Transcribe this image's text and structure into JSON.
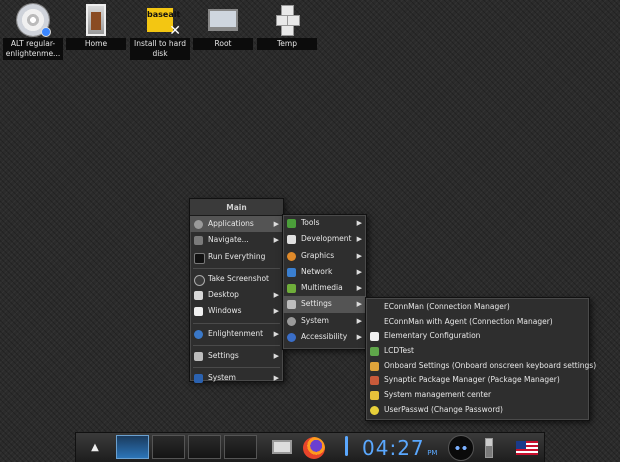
{
  "desktop": {
    "icons": [
      {
        "label": "ALT regular-enlightenme..."
      },
      {
        "label": "Home"
      },
      {
        "label": "Install to hard disk",
        "badge_text": "basealt"
      },
      {
        "label": "Root"
      },
      {
        "label": "Temp"
      }
    ]
  },
  "main_menu": {
    "title": "Main",
    "items": [
      {
        "label": "Applications",
        "icon": "gear-icon",
        "has_submenu": true
      },
      {
        "label": "Navigate...",
        "icon": "folder-icon",
        "has_submenu": true
      },
      {
        "label": "Run Everything",
        "icon": "terminal-icon",
        "has_submenu": false
      },
      {
        "label": "Take Screenshot",
        "icon": "camera-icon",
        "has_submenu": false
      },
      {
        "label": "Desktop",
        "icon": "desktop-icon",
        "has_submenu": true
      },
      {
        "label": "Windows",
        "icon": "window-icon",
        "has_submenu": true
      },
      {
        "label": "Enlightenment",
        "icon": "enlightenment-icon",
        "has_submenu": true
      },
      {
        "label": "Settings",
        "icon": "wrench-icon",
        "has_submenu": true
      },
      {
        "label": "System",
        "icon": "system-icon",
        "has_submenu": true
      }
    ]
  },
  "applications_menu": {
    "items": [
      {
        "label": "Tools",
        "icon": "tools-icon"
      },
      {
        "label": "Development",
        "icon": "development-icon"
      },
      {
        "label": "Graphics",
        "icon": "graphics-icon"
      },
      {
        "label": "Network",
        "icon": "network-icon"
      },
      {
        "label": "Multimedia",
        "icon": "multimedia-icon"
      },
      {
        "label": "Settings",
        "icon": "settings-icon"
      },
      {
        "label": "System",
        "icon": "system-icon"
      },
      {
        "label": "Accessibility",
        "icon": "accessibility-icon"
      }
    ]
  },
  "settings_menu": {
    "items": [
      {
        "label": "EConnMan (Connection Manager)",
        "icon": "connman-icon"
      },
      {
        "label": "EConnMan with Agent (Connection Manager)",
        "icon": "connman-icon"
      },
      {
        "label": "Elementary Configuration",
        "icon": "elementary-icon"
      },
      {
        "label": "LCDTest",
        "icon": "monitor-icon"
      },
      {
        "label": "Onboard Settings (Onboard onscreen keyboard settings)",
        "icon": "keyboard-icon"
      },
      {
        "label": "Synaptic Package Manager (Package Manager)",
        "icon": "package-icon"
      },
      {
        "label": "System management center",
        "icon": "control-center-icon"
      },
      {
        "label": "UserPasswd (Change Password)",
        "icon": "key-icon"
      }
    ]
  },
  "taskbar": {
    "clock": "04:27",
    "ampm": "PM",
    "flag": "us-flag-icon"
  },
  "colors": {
    "clock": "#5aa8ff",
    "menu_bg": "#2e2e2e",
    "highlight": "#545454"
  }
}
